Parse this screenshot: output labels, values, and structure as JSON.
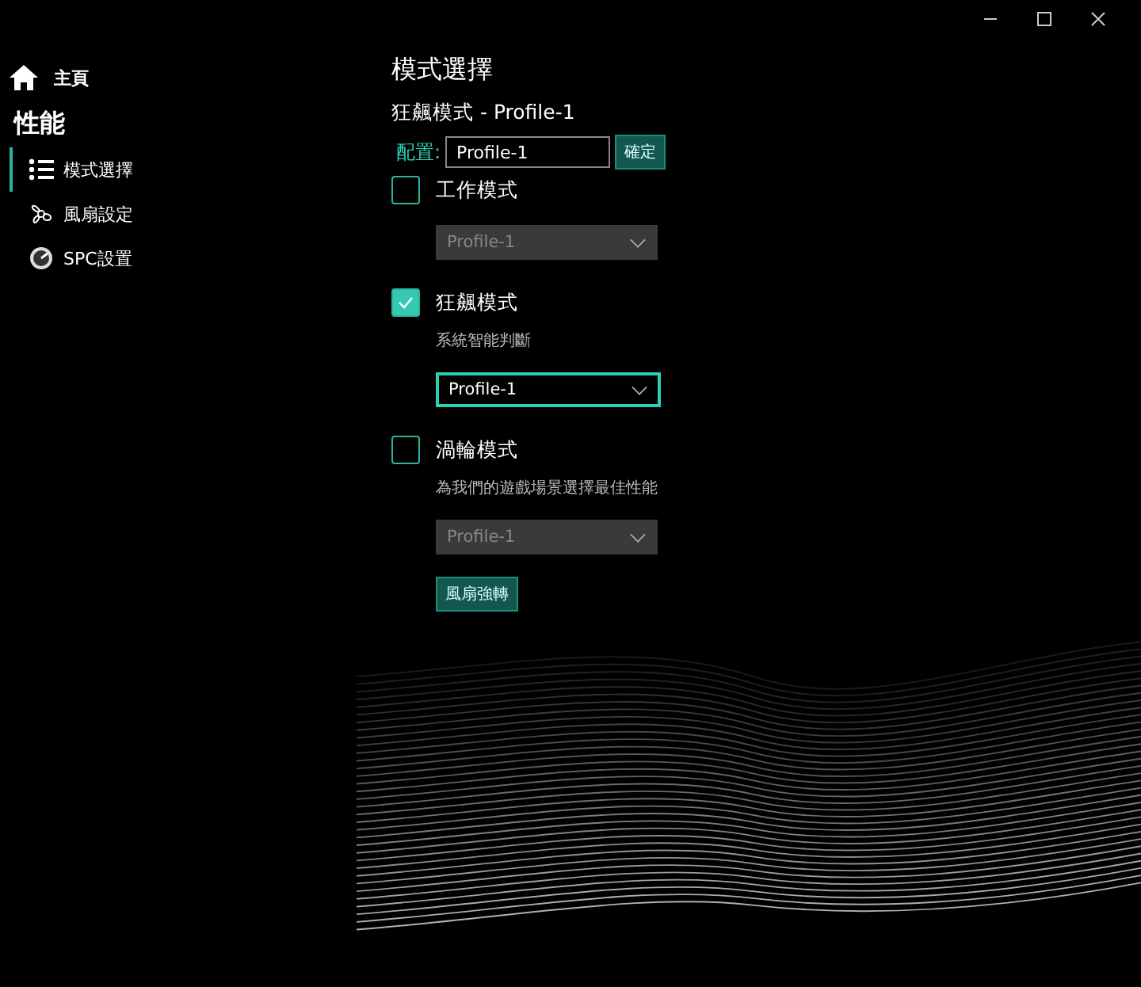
{
  "sidebar": {
    "home": "主頁",
    "section": "性能",
    "items": [
      {
        "label": "模式選擇",
        "selected": true
      },
      {
        "label": "風扇設定",
        "selected": false
      },
      {
        "label": "SPC設置",
        "selected": false
      }
    ]
  },
  "main": {
    "title": "模式選擇",
    "subtitle": "狂飆模式 - Profile-1",
    "config_label": "配置:",
    "config_value": "Profile-1",
    "confirm": "確定",
    "modes": [
      {
        "label": "工作模式",
        "checked": false,
        "dropdown": {
          "value": "Profile-1",
          "active": false
        }
      },
      {
        "label": "狂飆模式",
        "checked": true,
        "description": "系統智能判斷",
        "dropdown": {
          "value": "Profile-1",
          "active": true
        }
      },
      {
        "label": "渦輪模式",
        "checked": false,
        "description": "為我們的遊戲場景選擇最佳性能",
        "dropdown": {
          "value": "Profile-1",
          "active": false
        }
      }
    ],
    "fan_button": "風扇強轉"
  }
}
